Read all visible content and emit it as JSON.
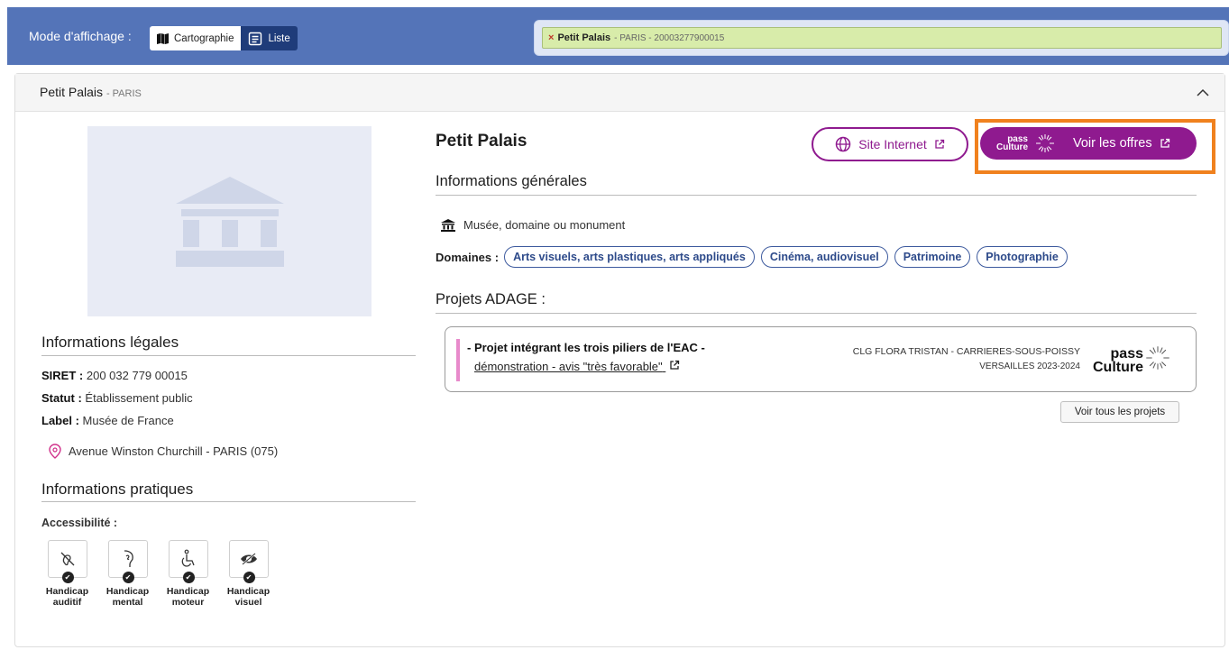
{
  "topbar": {
    "mode_label": "Mode d'affichage :",
    "mode_options": [
      {
        "label": "Cartographie",
        "icon": "map-icon",
        "active": true
      },
      {
        "label": "Liste",
        "icon": "list-icon",
        "active": false
      }
    ],
    "search_chip": {
      "title": "Petit Palais",
      "subtitle": "- PARIS - 20003277900015"
    }
  },
  "card": {
    "title": "Petit Palais",
    "title_sub": "- PARIS"
  },
  "left": {
    "legal_title": "Informations légales",
    "siret_label": "SIRET :",
    "siret_value": "200 032 779 00015",
    "statut_label": "Statut :",
    "statut_value": "Établissement public",
    "label_label": "Label :",
    "label_value": "Musée de France",
    "address": "Avenue Winston Churchill - PARIS (075)",
    "practical_title": "Informations pratiques",
    "accessibility_label": "Accessibilité :",
    "accessibility": [
      {
        "line1": "Handicap",
        "line2": "auditif",
        "icon": "hearing-impaired-icon"
      },
      {
        "line1": "Handicap",
        "line2": "mental",
        "icon": "mental-disability-icon"
      },
      {
        "line1": "Handicap",
        "line2": "moteur",
        "icon": "wheelchair-icon"
      },
      {
        "line1": "Handicap",
        "line2": "visuel",
        "icon": "visual-impaired-icon"
      }
    ]
  },
  "right": {
    "venue_name": "Petit Palais",
    "site_button": "Site Internet",
    "offers_logo_line1": "pass",
    "offers_logo_line2": "Culture",
    "offers_button": "Voir les offres",
    "general_title": "Informations générales",
    "venue_type": "Musée, domaine ou monument",
    "domains_label": "Domaines :",
    "domains": [
      "Arts visuels, arts plastiques, arts appliqués",
      "Cinéma, audiovisuel",
      "Patrimoine",
      "Photographie"
    ],
    "projects_title": "Projets ADAGE :",
    "project": {
      "title": "- Projet intégrant les trois piliers de l'EAC -",
      "link": "démonstration - avis \"très favorable\"",
      "school": "CLG FLORA TRISTAN - CARRIERES-SOUS-POISSY",
      "year": "VERSAILLES 2023-2024",
      "logo_line1": "pass",
      "logo_line2": "Culture"
    },
    "all_projects_button": "Voir tous les projets"
  },
  "colors": {
    "topbar": "#5474b8",
    "accent_purple": "#8f1a8f",
    "highlight_orange": "#f0811e",
    "pill_blue": "#3d5a9e"
  }
}
